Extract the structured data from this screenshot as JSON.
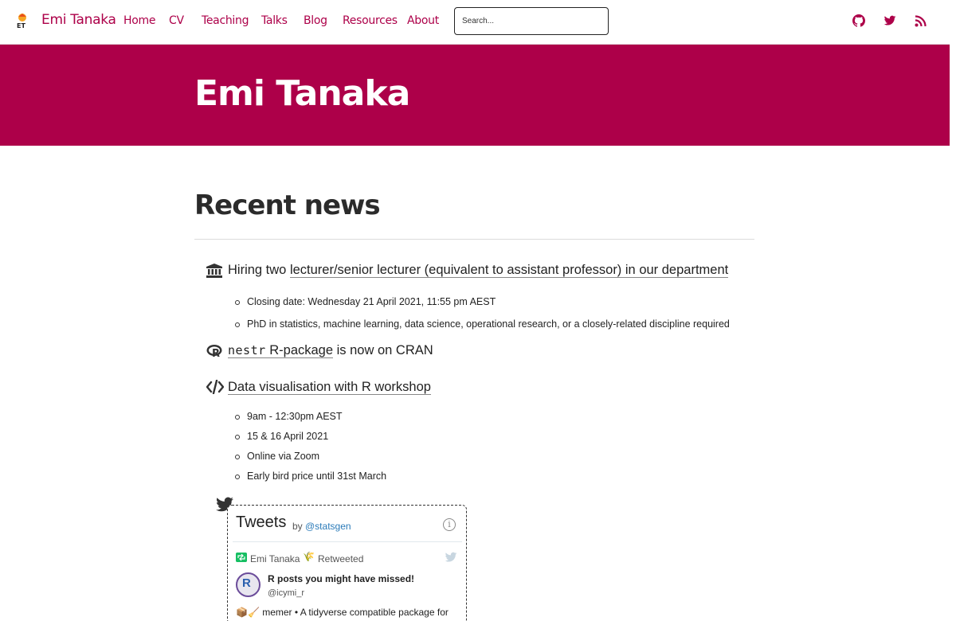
{
  "nav": {
    "logo_text": "ET",
    "brand": "Emi Tanaka",
    "items": [
      "Home",
      "CV",
      "Teaching",
      "Talks",
      "Blog",
      "Resources",
      "About"
    ],
    "search_placeholder": "Search...",
    "social_icons": [
      "github-icon",
      "twitter-icon",
      "rss-icon"
    ],
    "accent_color": "#ad0049"
  },
  "hero": {
    "title": "Emi Tanaka",
    "background_color": "#ad0049"
  },
  "main": {
    "section_title": "Recent news",
    "news": [
      {
        "icon": "university-icon",
        "prefix": "Hiring two ",
        "link": "lecturer/senior lecturer (equivalent to assistant professor) in our department",
        "bullets": [
          "Closing date: Wednesday 21 April 2021, 11:55 pm AEST",
          "PhD in statistics, machine learning, data science, operational research, or a closely-related discipline required"
        ]
      },
      {
        "icon": "r-project-icon",
        "code": "nestr",
        "link_suffix": " R-package",
        "suffix": " is now on CRAN"
      },
      {
        "icon": "code-icon",
        "link": "Data visualisation with R workshop",
        "bullets": [
          "9am - 12:30pm AEST",
          "15 & 16 April 2021",
          "Online via Zoom",
          "Early bird price until 31st March"
        ]
      }
    ]
  },
  "twitter": {
    "header": "Tweets",
    "by": "by",
    "handle": "@statsgen",
    "info": "i",
    "retweeter": "Emi Tanaka",
    "retweeter_emoji": "🌾",
    "retweet_label": "Retweeted",
    "author_name": "R posts you might have missed!",
    "author_handle": "@icymi_r",
    "tweet_text": "📦🧹 memer • A tidyverse compatible package for"
  }
}
